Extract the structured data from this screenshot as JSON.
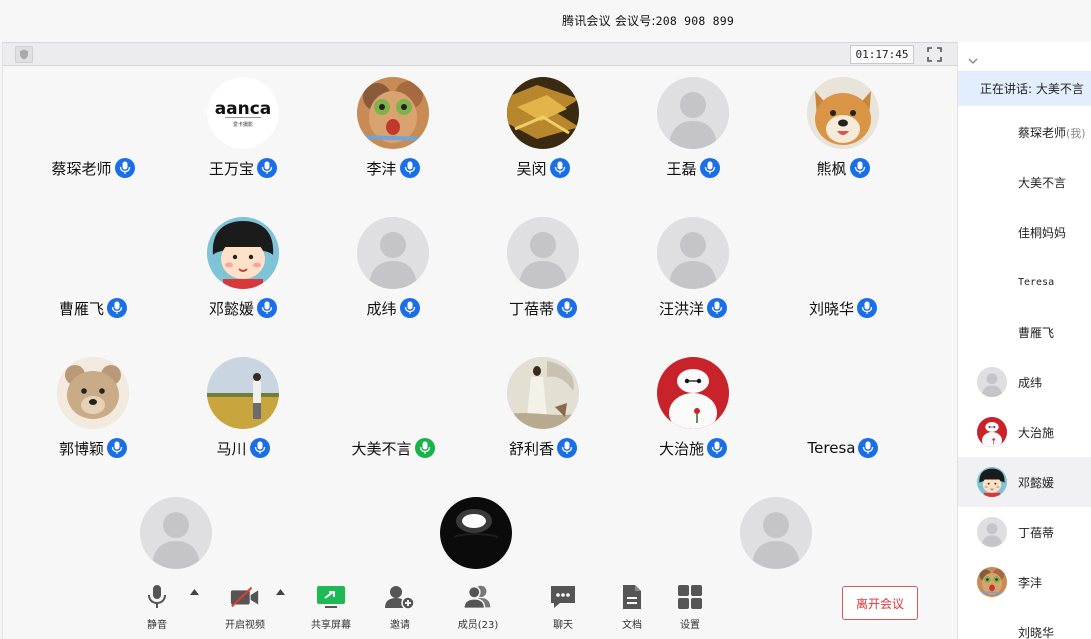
{
  "window": {
    "title_prefix": "腾讯会议",
    "meeting_id_label": "会议号:",
    "meeting_id": "208 908 899"
  },
  "topbar": {
    "timer": "01:17:45"
  },
  "participants": [
    {
      "name": "蔡琛老师",
      "avatar": "none"
    },
    {
      "name": "王万宝",
      "avatar": "aanca-logo"
    },
    {
      "name": "李沣",
      "avatar": "cat-art"
    },
    {
      "name": "吴闵",
      "avatar": "golden-art"
    },
    {
      "name": "王磊",
      "avatar": "default"
    },
    {
      "name": "熊枫",
      "avatar": "shiba-dog"
    },
    {
      "name": "曹雁飞",
      "avatar": "none"
    },
    {
      "name": "邓懿媛",
      "avatar": "cartoon-girl"
    },
    {
      "name": "成纬",
      "avatar": "default"
    },
    {
      "name": "丁蓓蒂",
      "avatar": "default"
    },
    {
      "name": "汪洪洋",
      "avatar": "default"
    },
    {
      "name": "刘晓华",
      "avatar": "none"
    },
    {
      "name": "郭博颖",
      "avatar": "teddy-bear"
    },
    {
      "name": "马川",
      "avatar": "field-photo"
    },
    {
      "name": "大美不言",
      "avatar": "none"
    },
    {
      "name": "舒利香",
      "avatar": "painting"
    },
    {
      "name": "大治施",
      "avatar": "baymax"
    },
    {
      "name": "Teresa",
      "avatar": "none"
    },
    {
      "name": "",
      "avatar": "default"
    },
    {
      "name": "",
      "avatar": "lamp"
    },
    {
      "name": "",
      "avatar": "default"
    }
  ],
  "logo_text": "aanca",
  "logo_sub": "爱卡摄影",
  "toolbar": {
    "mute": "静音",
    "video": "开启视频",
    "share": "共享屏幕",
    "invite": "邀请",
    "members": "成员(23)",
    "chat": "聊天",
    "docs": "文档",
    "settings": "设置",
    "leave": "离开会议"
  },
  "sidebar": {
    "speaking": "正在讲话: 大美不言",
    "members": [
      {
        "name": "蔡琛老师",
        "suffix": "(我)"
      },
      {
        "name": "大美不言",
        "suffix": ""
      },
      {
        "name": "佳桐妈妈",
        "suffix": ""
      },
      {
        "name": "Teresa",
        "suffix": ""
      },
      {
        "name": "曹雁飞",
        "suffix": ""
      },
      {
        "name": "成纬",
        "suffix": ""
      },
      {
        "name": "大治施",
        "suffix": ""
      },
      {
        "name": "邓懿媛",
        "suffix": ""
      },
      {
        "name": "丁蓓蒂",
        "suffix": ""
      },
      {
        "name": "李沣",
        "suffix": ""
      },
      {
        "name": "刘晓华",
        "suffix": ""
      }
    ]
  },
  "colors": {
    "accent": "#1a6ee6",
    "speaking_mic": "#19b34b",
    "share_green": "#1db954",
    "leave_red": "#e03535"
  }
}
